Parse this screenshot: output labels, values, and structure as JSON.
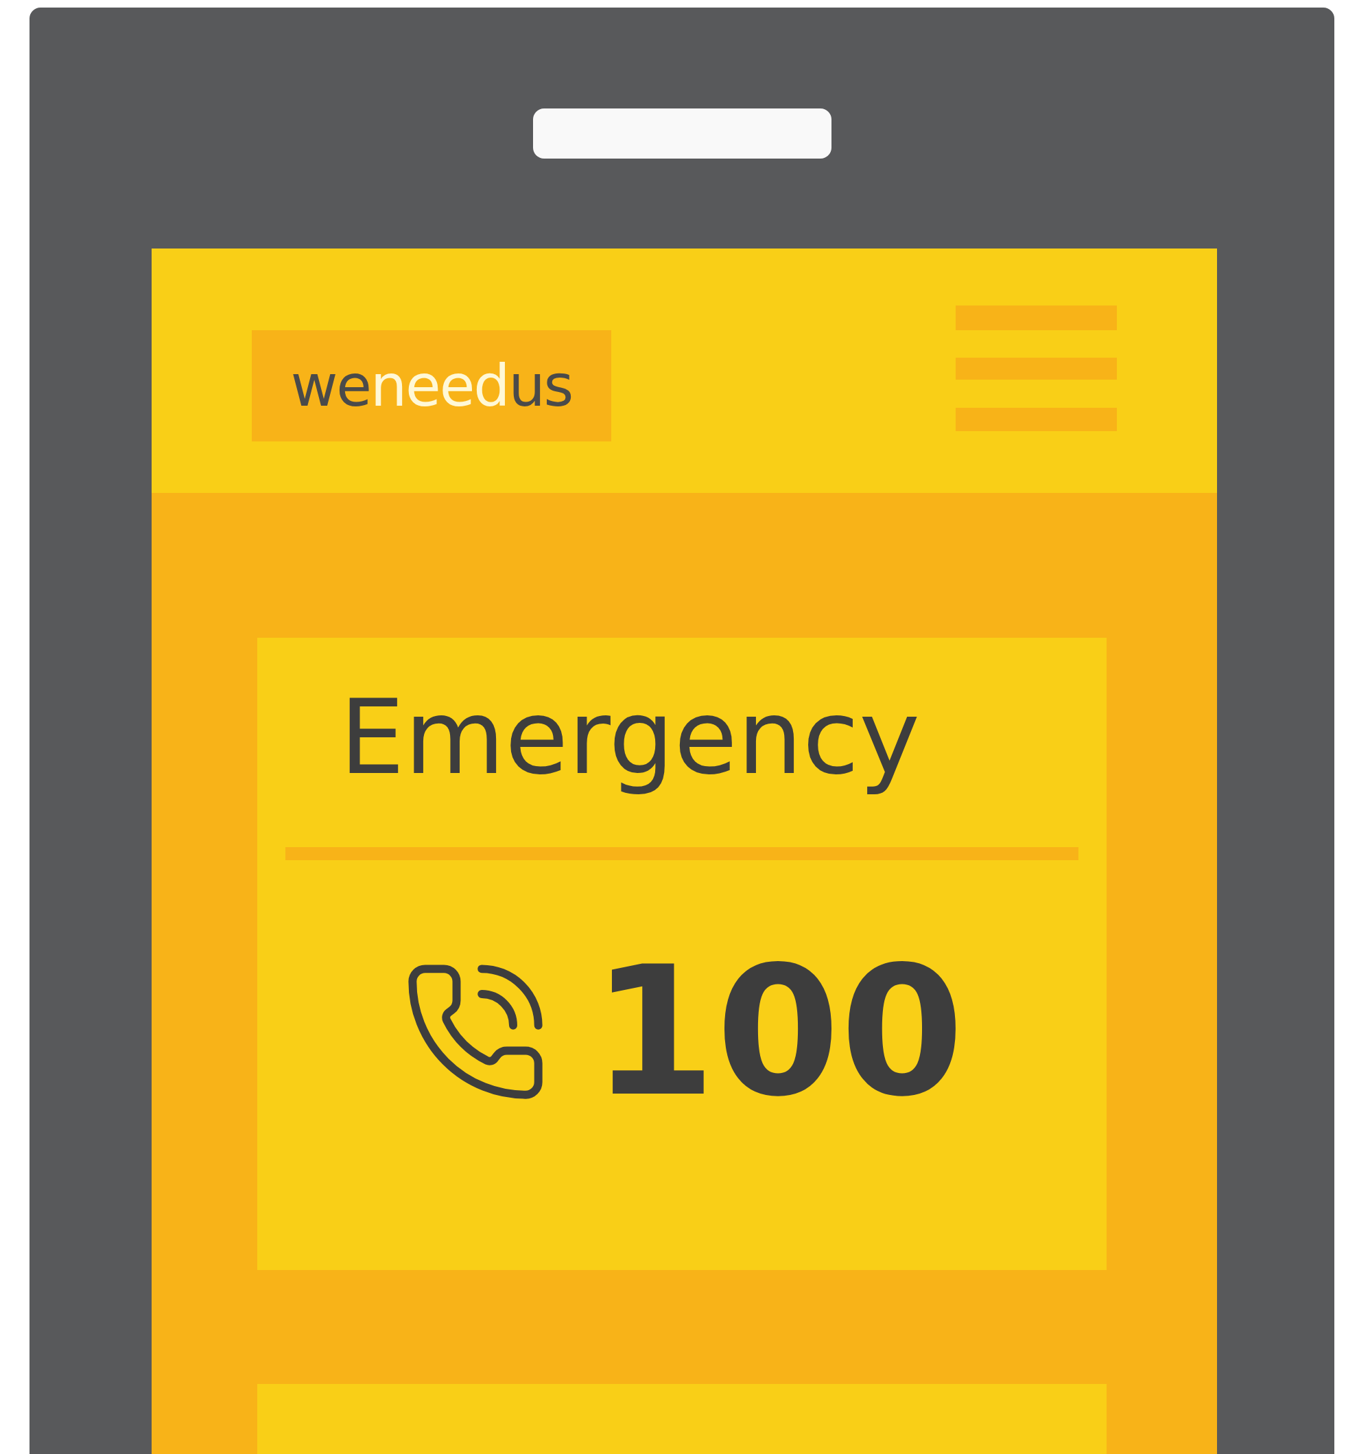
{
  "header": {
    "logo": [
      {
        "text": "we",
        "kind": "dark"
      },
      {
        "text": "need",
        "kind": "light"
      },
      {
        "text": "us",
        "kind": "dark"
      }
    ]
  },
  "cards": [
    {
      "title": "Emergency",
      "number": "100"
    }
  ]
}
